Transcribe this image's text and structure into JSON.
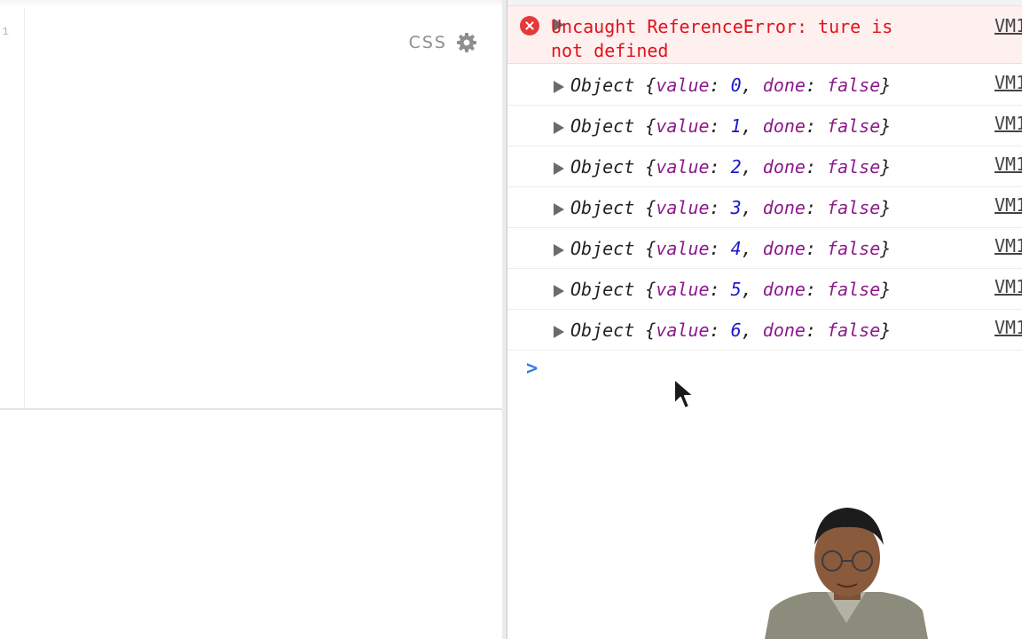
{
  "editor": {
    "line_number": "1",
    "language_label": "CSS",
    "settings_icon": "gear-icon"
  },
  "console": {
    "error": {
      "icon": "error-circle-icon",
      "expand_icon": "triangle-right-icon",
      "message": "Uncaught ReferenceError: ture is\nnot defined",
      "source": "VM1"
    },
    "logs": [
      {
        "prefix": "Object {",
        "key1": "value",
        "sep1": ": ",
        "value": "0",
        "sep2": ", ",
        "key2": "done",
        "sep3": ": ",
        "done": "false",
        "suffix": "}",
        "source": "VM1"
      },
      {
        "prefix": "Object {",
        "key1": "value",
        "sep1": ": ",
        "value": "1",
        "sep2": ", ",
        "key2": "done",
        "sep3": ": ",
        "done": "false",
        "suffix": "}",
        "source": "VM1"
      },
      {
        "prefix": "Object {",
        "key1": "value",
        "sep1": ": ",
        "value": "2",
        "sep2": ", ",
        "key2": "done",
        "sep3": ": ",
        "done": "false",
        "suffix": "}",
        "source": "VM1"
      },
      {
        "prefix": "Object {",
        "key1": "value",
        "sep1": ": ",
        "value": "3",
        "sep2": ", ",
        "key2": "done",
        "sep3": ": ",
        "done": "false",
        "suffix": "}",
        "source": "VM1"
      },
      {
        "prefix": "Object {",
        "key1": "value",
        "sep1": ": ",
        "value": "4",
        "sep2": ", ",
        "key2": "done",
        "sep3": ": ",
        "done": "false",
        "suffix": "}",
        "source": "VM1"
      },
      {
        "prefix": "Object {",
        "key1": "value",
        "sep1": ": ",
        "value": "5",
        "sep2": ", ",
        "key2": "done",
        "sep3": ": ",
        "done": "false",
        "suffix": "}",
        "source": "VM1"
      },
      {
        "prefix": "Object {",
        "key1": "value",
        "sep1": ": ",
        "value": "6",
        "sep2": ", ",
        "key2": "done",
        "sep3": ": ",
        "done": "false",
        "suffix": "}",
        "source": "VM1"
      }
    ],
    "prompt_symbol": ">"
  },
  "colors": {
    "error_text": "#e0121b",
    "error_background": "#fff0f0",
    "property_key": "#8a1a8a",
    "number_value": "#1c1ac9",
    "prompt": "#3a7be6"
  }
}
